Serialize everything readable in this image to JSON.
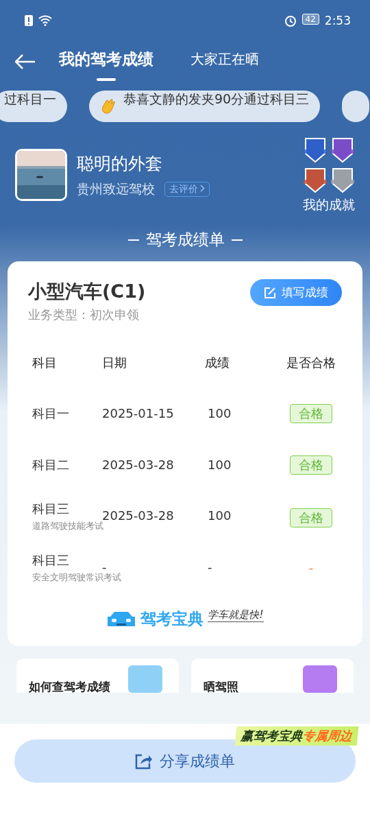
{
  "status_bar": {
    "time": "2:53",
    "battery": "42"
  },
  "tabs": [
    {
      "label": "我的驾考成绩",
      "selected": true
    },
    {
      "label": "大家正在晒",
      "selected": false
    }
  ],
  "ticker": [
    "过科目一",
    "恭喜文静的发夹90分通过科目三"
  ],
  "profile": {
    "name": "聪明的外套",
    "school": "贵州致远驾校",
    "review_link": "去评价",
    "achievements_label": "我的成就"
  },
  "section_title": "驾考成绩单",
  "report": {
    "vehicle": "小型汽车(C1)",
    "business_type": "业务类型：初次申领",
    "fill_button": "填写成绩",
    "columns": [
      "科目",
      "日期",
      "成绩",
      "是否合格"
    ],
    "rows": [
      {
        "subject": "科目一",
        "date": "2025-01-15",
        "score": "100",
        "result": "合格",
        "passed": true
      },
      {
        "subject": "科目二",
        "date": "2025-03-28",
        "score": "100",
        "result": "合格",
        "passed": true
      },
      {
        "subject": "科目三",
        "note": "道路驾驶技能考试",
        "date": "2025-03-28",
        "score": "100",
        "result": "合格",
        "passed": true
      },
      {
        "subject": "科目三",
        "note": "安全文明驾驶常识考试",
        "date": "-",
        "score": "-",
        "result": "-",
        "passed": false
      }
    ],
    "brand": "驾考宝典",
    "slogan": "学车就是快!"
  },
  "cards": [
    "如何查驾考成绩",
    "晒驾照"
  ],
  "promo": {
    "main": "赢驾考宝典",
    "highlight": "专属周边"
  },
  "share_button": "分享成绩单"
}
